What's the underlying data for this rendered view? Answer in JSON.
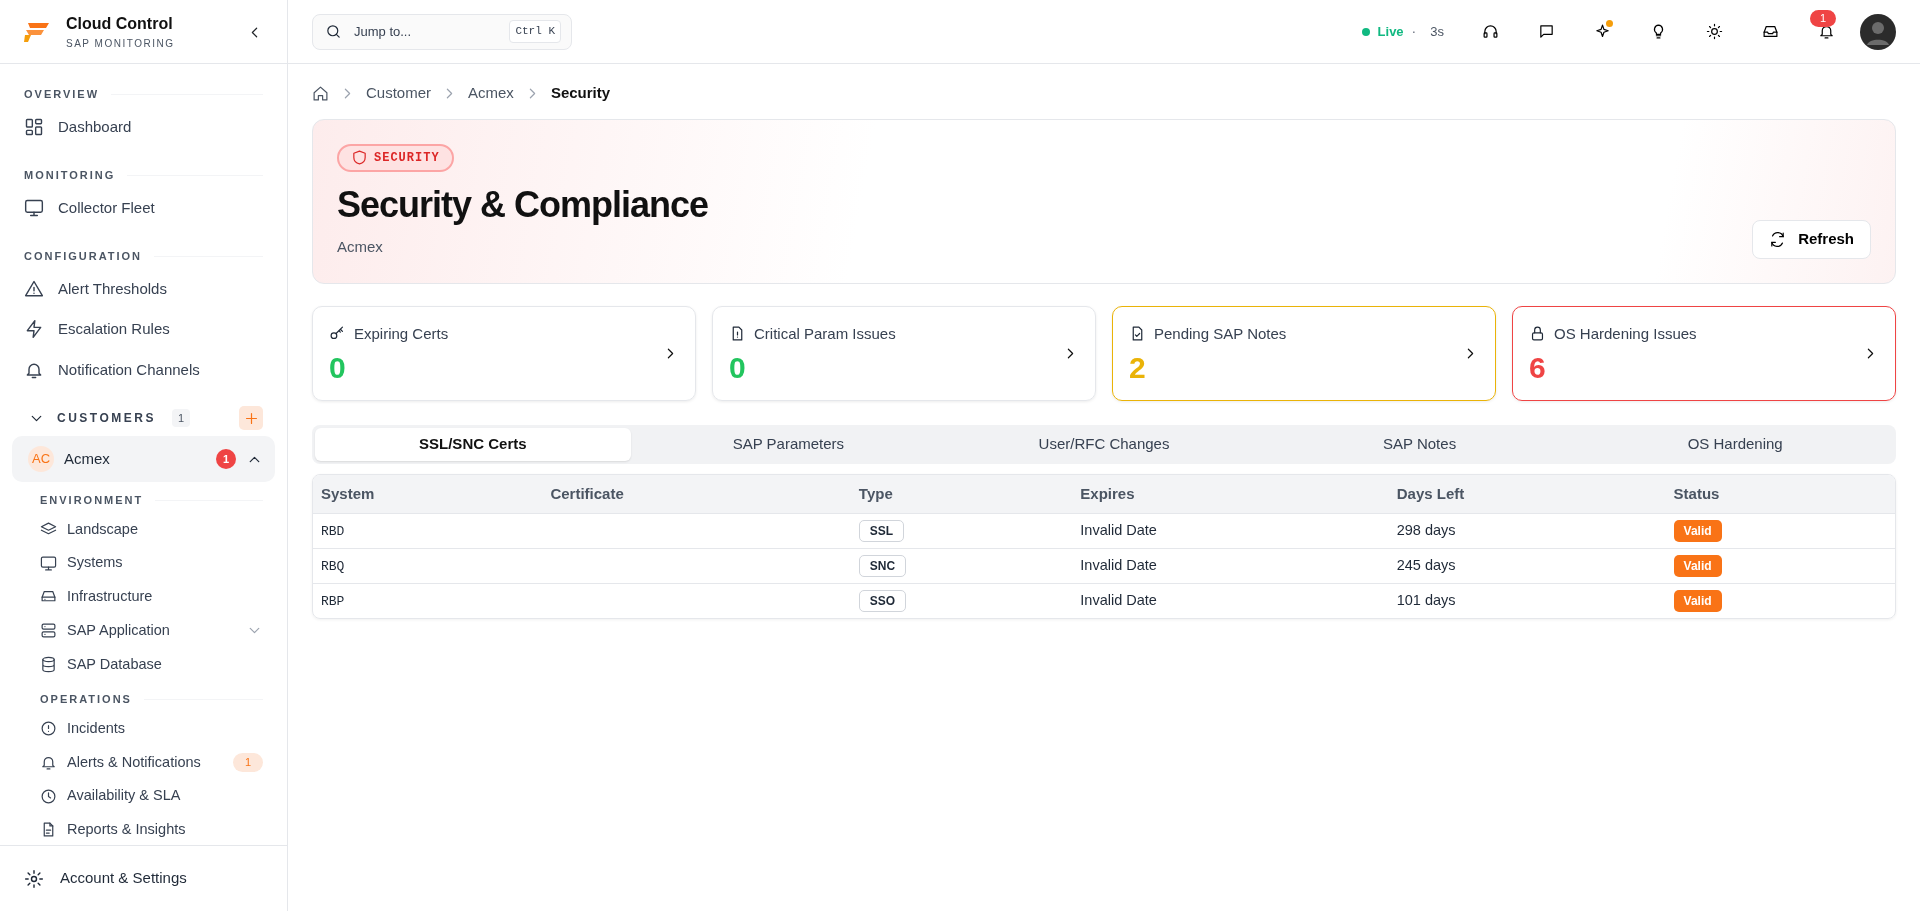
{
  "brand": {
    "title": "Cloud Control",
    "subtitle": "SAP MONITORING"
  },
  "sidebar": {
    "sections": [
      {
        "heading": "OVERVIEW",
        "items": [
          {
            "label": "Dashboard"
          }
        ]
      },
      {
        "heading": "MONITORING",
        "items": [
          {
            "label": "Collector Fleet"
          }
        ]
      },
      {
        "heading": "CONFIGURATION",
        "items": [
          {
            "label": "Alert Thresholds"
          },
          {
            "label": "Escalation Rules"
          },
          {
            "label": "Notification Channels"
          }
        ]
      }
    ],
    "customers": {
      "label": "CUSTOMERS",
      "count": "1",
      "items": [
        {
          "initials": "AC",
          "name": "Acmex",
          "badge": "1",
          "expanded": true,
          "selected": true
        }
      ]
    },
    "customer_sections": [
      {
        "heading": "ENVIRONMENT",
        "items": [
          {
            "label": "Landscape"
          },
          {
            "label": "Systems"
          },
          {
            "label": "Infrastructure"
          },
          {
            "label": "SAP Application",
            "expanded": false
          },
          {
            "label": "SAP Database"
          }
        ]
      },
      {
        "heading": "OPERATIONS",
        "items": [
          {
            "label": "Incidents"
          },
          {
            "label": "Alerts & Notifications",
            "badge": "1"
          },
          {
            "label": "Availability & SLA"
          },
          {
            "label": "Reports & Insights"
          }
        ]
      }
    ],
    "footer": {
      "label": "Account & Settings"
    }
  },
  "topbar": {
    "search": {
      "placeholder": "Jump to...",
      "shortcut": "Ctrl K"
    },
    "live": {
      "label": "Live",
      "separator": "·",
      "age": "3s"
    },
    "notifications": {
      "count": "1"
    }
  },
  "breadcrumb": [
    "Customer",
    "Acmex",
    "Security"
  ],
  "hero": {
    "tag": "SECURITY",
    "title": "Security & Compliance",
    "subtitle": "Acmex",
    "button": "Refresh"
  },
  "stats": [
    {
      "label": "Expiring Certs",
      "value": "0",
      "color": "#22c55e",
      "alert": false
    },
    {
      "label": "Critical Param Issues",
      "value": "0",
      "color": "#22c55e",
      "alert": false
    },
    {
      "label": "Pending SAP Notes",
      "value": "2",
      "color": "#eab308",
      "alert": true
    },
    {
      "label": "OS Hardening Issues",
      "value": "6",
      "color": "#ef4444",
      "alert": true
    }
  ],
  "tabs": [
    {
      "label": "SSL/SNC Certs",
      "selected": true
    },
    {
      "label": "SAP Parameters",
      "selected": false
    },
    {
      "label": "User/RFC Changes",
      "selected": false
    },
    {
      "label": "SAP Notes",
      "selected": false
    },
    {
      "label": "OS Hardening",
      "selected": false
    }
  ],
  "table": {
    "columns": [
      "System",
      "Certificate",
      "Type",
      "Expires",
      "Days Left",
      "Status"
    ],
    "rows": [
      {
        "system": "RBD",
        "type": "SSL",
        "expires": "Invalid Date",
        "days_left": "298 days",
        "status": "Valid"
      },
      {
        "system": "RBQ",
        "type": "SNC",
        "expires": "Invalid Date",
        "days_left": "245 days",
        "status": "Valid"
      },
      {
        "system": "RBP",
        "type": "SSO",
        "expires": "Invalid Date",
        "days_left": "101 days",
        "status": "Valid"
      }
    ]
  }
}
